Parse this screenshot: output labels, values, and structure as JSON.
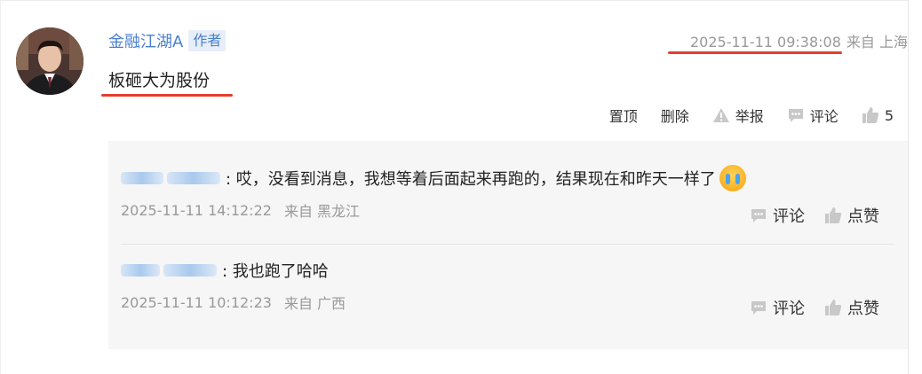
{
  "comment": {
    "author": "金融江湖A",
    "author_badge": "作者",
    "time": "2025-11-11 09:38:08",
    "source": "来自 上海",
    "content": "板砸大为股份",
    "actions": {
      "pin": "置顶",
      "delete": "删除",
      "report": "举报",
      "comment": "评论",
      "like_count": "5"
    }
  },
  "replies": [
    {
      "text": ": 哎，没看到消息，我想等着后面起来再跑的，结果现在和昨天一样了",
      "time": "2025-11-11 14:12:22",
      "source": "来自 黑龙江",
      "comment_label": "评论",
      "like_label": "点赞"
    },
    {
      "text": ": 我也跑了哈哈",
      "time": "2025-11-11 10:12:23",
      "source": "来自 广西",
      "comment_label": "评论",
      "like_label": "点赞"
    }
  ],
  "colors": {
    "author_link": "#4a7fcf",
    "highlight_underline": "#e53e2f",
    "reply_background": "#f6f6f6",
    "muted_text": "#999999"
  }
}
